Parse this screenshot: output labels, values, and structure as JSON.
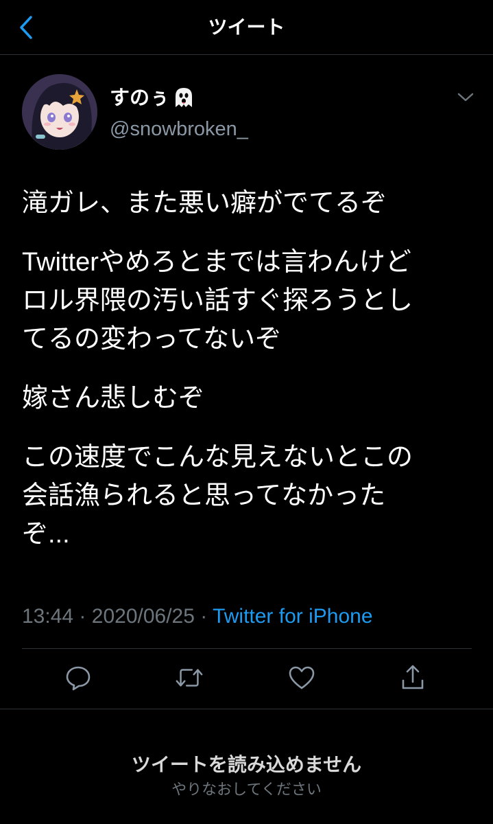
{
  "header": {
    "title": "ツイート",
    "back_icon": "chevron-left-icon",
    "accent_color": "#1d9bf0"
  },
  "tweet": {
    "author": {
      "display_name": "すのぅ",
      "emoji": "ghost-emoji",
      "handle": "@snowbroken_"
    },
    "body": [
      "滝ガレ、また悪い癖がでてるぞ",
      "Twitterやめろとまでは言わんけど\nロル界隈の汚い話すぐ探ろうとし\nてるの変わってないぞ",
      "嫁さん悲しむぞ",
      "この速度でこんな見えないとこの\n会話漁られると思ってなかった\nぞ..."
    ],
    "time": "13:44",
    "separator": "·",
    "date": "2020/06/25",
    "source": "Twitter for iPhone"
  },
  "actions": [
    {
      "icon": "reply-icon"
    },
    {
      "icon": "retweet-icon"
    },
    {
      "icon": "like-icon"
    },
    {
      "icon": "share-icon"
    }
  ],
  "error": {
    "title": "ツイートを読み込めません",
    "subtitle": "やりなおしてください"
  }
}
